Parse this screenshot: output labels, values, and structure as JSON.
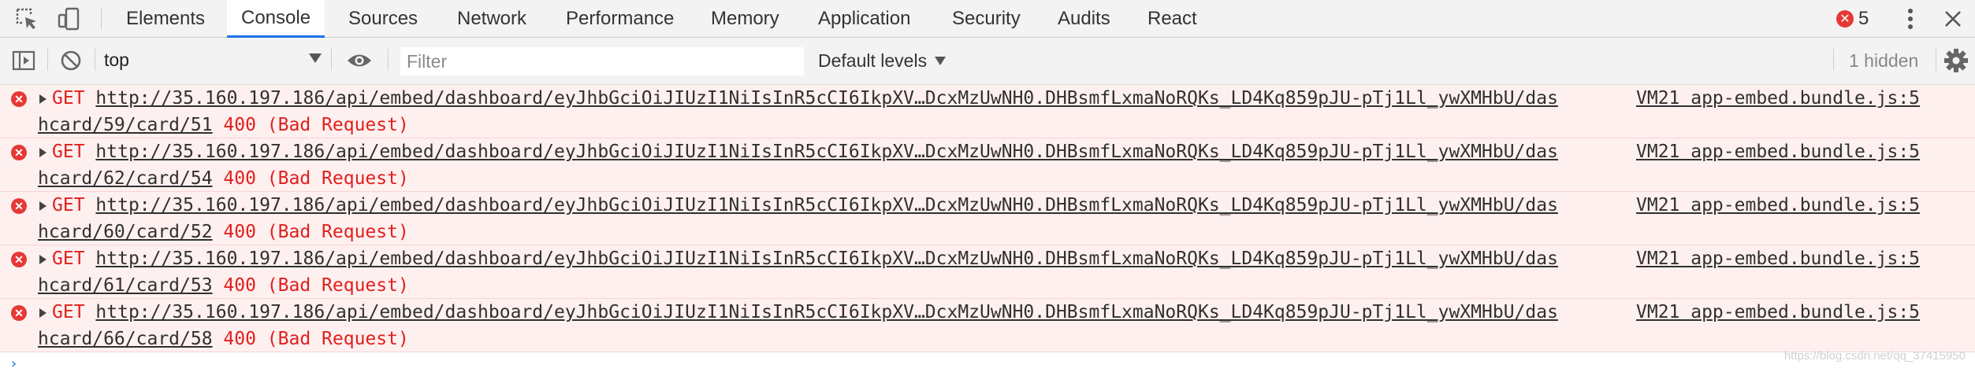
{
  "tabs": [
    {
      "label": "Elements",
      "active": false
    },
    {
      "label": "Console",
      "active": true
    },
    {
      "label": "Sources",
      "active": false
    },
    {
      "label": "Network",
      "active": false
    },
    {
      "label": "Performance",
      "active": false
    },
    {
      "label": "Memory",
      "active": false
    },
    {
      "label": "Application",
      "active": false
    },
    {
      "label": "Security",
      "active": false
    },
    {
      "label": "Audits",
      "active": false
    },
    {
      "label": "React",
      "active": false
    }
  ],
  "error_count": "5",
  "toolbar": {
    "context": "top",
    "filter_placeholder": "Filter",
    "levels": "Default levels",
    "hidden": "1 hidden"
  },
  "messages": [
    {
      "method": "GET",
      "url_line1": "http://35.160.197.186/api/embed/dashboard/eyJhbGciOiJIUzI1NiIsInR5cCI6IkpXV…DcxMzUwNH0.DHBsmfLxmaNoRQKs_LD4Kq859pJU-pTj1Ll_ywXMHbU/das",
      "url_line2": "hcard/59/card/51",
      "status": "400 (Bad Request)",
      "source": "VM21 app-embed.bundle.js:5"
    },
    {
      "method": "GET",
      "url_line1": "http://35.160.197.186/api/embed/dashboard/eyJhbGciOiJIUzI1NiIsInR5cCI6IkpXV…DcxMzUwNH0.DHBsmfLxmaNoRQKs_LD4Kq859pJU-pTj1Ll_ywXMHbU/das",
      "url_line2": "hcard/62/card/54",
      "status": "400 (Bad Request)",
      "source": "VM21 app-embed.bundle.js:5"
    },
    {
      "method": "GET",
      "url_line1": "http://35.160.197.186/api/embed/dashboard/eyJhbGciOiJIUzI1NiIsInR5cCI6IkpXV…DcxMzUwNH0.DHBsmfLxmaNoRQKs_LD4Kq859pJU-pTj1Ll_ywXMHbU/das",
      "url_line2": "hcard/60/card/52",
      "status": "400 (Bad Request)",
      "source": "VM21 app-embed.bundle.js:5"
    },
    {
      "method": "GET",
      "url_line1": "http://35.160.197.186/api/embed/dashboard/eyJhbGciOiJIUzI1NiIsInR5cCI6IkpXV…DcxMzUwNH0.DHBsmfLxmaNoRQKs_LD4Kq859pJU-pTj1Ll_ywXMHbU/das",
      "url_line2": "hcard/61/card/53",
      "status": "400 (Bad Request)",
      "source": "VM21 app-embed.bundle.js:5"
    },
    {
      "method": "GET",
      "url_line1": "http://35.160.197.186/api/embed/dashboard/eyJhbGciOiJIUzI1NiIsInR5cCI6IkpXV…DcxMzUwNH0.DHBsmfLxmaNoRQKs_LD4Kq859pJU-pTj1Ll_ywXMHbU/das",
      "url_line2": "hcard/66/card/58",
      "status": "400 (Bad Request)",
      "source": "VM21 app-embed.bundle.js:5"
    }
  ],
  "watermark": "https://blog.csdn.net/qq_37415950",
  "icons": {
    "inspect": "inspect-element-icon",
    "device": "device-toolbar-icon",
    "sidebar": "show-sidebar-icon",
    "clear": "clear-console-icon",
    "eye": "live-expression-eye-icon",
    "error": "error-circle-icon",
    "more": "more-vertical-icon",
    "close": "close-icon",
    "settings": "gear-icon"
  },
  "colors": {
    "error_text": "#e0201c",
    "error_bg": "#fff0f0",
    "active_tab": "#1a73e8"
  }
}
